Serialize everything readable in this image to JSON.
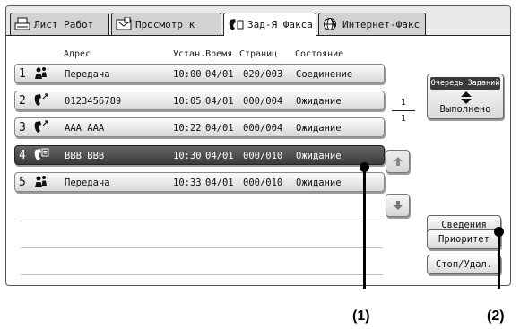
{
  "tabs": [
    {
      "label": "Лист Работ",
      "icon": "print-icon",
      "active": false
    },
    {
      "label": "Просмотр к",
      "icon": "scan-icon",
      "active": false
    },
    {
      "label": "Зад-Я Факса",
      "icon": "fax-icon",
      "active": true
    },
    {
      "label": "Интернет-Факс",
      "icon": "internet-fax-icon",
      "active": false
    }
  ],
  "columns": {
    "address": "Адрес",
    "set_time": "Устан.Время",
    "pages": "Страниц",
    "status": "Состояние"
  },
  "jobs": [
    {
      "num": "1",
      "icon": "broadcast-icon",
      "address": "Передача",
      "time": "10:00",
      "date": "04/01",
      "pages": "020/003",
      "status": "Соединение",
      "selected": false
    },
    {
      "num": "2",
      "icon": "phone-send-icon",
      "address": "0123456789",
      "time": "10:05",
      "date": "04/01",
      "pages": "000/004",
      "status": "Ожидание",
      "selected": false
    },
    {
      "num": "3",
      "icon": "phone-send-icon",
      "address": "AAA AAA",
      "time": "10:22",
      "date": "04/01",
      "pages": "000/004",
      "status": "Ожидание",
      "selected": false
    },
    {
      "num": "4",
      "icon": "phone-book-icon",
      "address": "BBB BBB",
      "time": "10:30",
      "date": "04/01",
      "pages": "000/010",
      "status": "Ожидание",
      "selected": true
    },
    {
      "num": "5",
      "icon": "broadcast-icon",
      "address": "Передача",
      "time": "10:33",
      "date": "04/01",
      "pages": "000/010",
      "status": "Ожидание",
      "selected": false
    }
  ],
  "pagination": {
    "current": "1",
    "total": "1"
  },
  "queue_toggle": {
    "top_label": "Очередь Заданий",
    "bottom_label": "Выполнено"
  },
  "buttons": {
    "details": "Сведения",
    "priority": "Приоритет",
    "stop_delete": "Стоп/Удал."
  },
  "callouts": {
    "one": "(1)",
    "two": "(2)"
  }
}
